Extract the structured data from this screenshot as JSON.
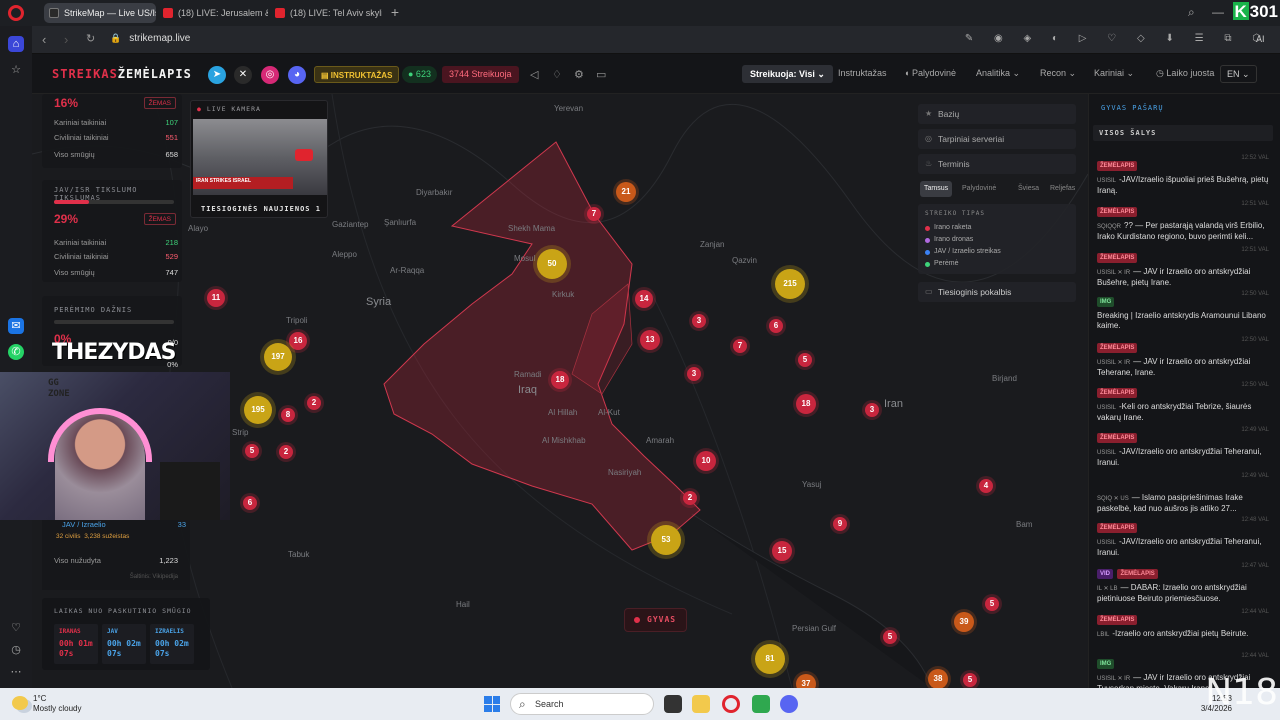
{
  "browser": {
    "tabs": [
      {
        "label": "StrikeMap — Live US/Isra"
      },
      {
        "label": "(18) LIVE: Jerusalem &"
      },
      {
        "label": "(18) LIVE: Tel Aviv skyline I"
      }
    ],
    "url": "strikemap.live",
    "ai_label": "AI",
    "corner_count": "301"
  },
  "header": {
    "logo_a": "STREIKAS",
    "logo_b": "ŽEMĖLAPIS",
    "instructions": "INSTRUKTAŽAS",
    "online_count": "● 623",
    "strike_count": "3744 Streikuoja",
    "menu_active": "Streikuoja: Visi ⌄",
    "menu": [
      "Instruktažas",
      "Palydovinė",
      "Analitika",
      "Recon",
      "Kariniai",
      "Laiko juosta"
    ],
    "lang": "EN ⌄"
  },
  "left_panel": {
    "top_pct": "16%",
    "top_badge": "ŽEMAS",
    "top_rows": [
      {
        "label": "Kariniai taikiniai",
        "value": "107"
      },
      {
        "label": "Civiliniai taikiniai",
        "value": "551"
      },
      {
        "label": "Viso smūgių",
        "value": "658"
      }
    ],
    "acc_title": "JAV/ISR TIKSLUMO TIKSLUMAS",
    "acc_pct": "29%",
    "acc_badge": "ŽEMAS",
    "acc_fill": 0.29,
    "acc_rows": [
      {
        "label": "Kariniai taikiniai",
        "value": "218"
      },
      {
        "label": "Civiliniai taikiniai",
        "value": "529"
      },
      {
        "label": "Viso smūgių",
        "value": "747"
      }
    ],
    "intercept_title": "PERĖMIMO DAŽNIS",
    "intercept_pct": "0%",
    "intercept_vals": [
      "0/0",
      "0%"
    ],
    "webcam_rows": {
      "side": "JAV / Izraelio",
      "side_val": "33",
      "civ": "32 civilis",
      "inj": "3,238 sužeistas",
      "killed_label": "Viso nužudyta",
      "killed_val": "1,223",
      "source": "Šaltinis: Vikipedija"
    }
  },
  "camera": {
    "title": "LIVE KAMERA",
    "news_text": "IRAN STRIKES ISRAEL",
    "footer": "TIESIOGINĖS NAUJIENOS 1"
  },
  "streamer": {
    "name": "THEZYDAS",
    "art": [
      "GG",
      "ZONE"
    ]
  },
  "map": {
    "labels": [
      {
        "t": "Yerevan",
        "cls": ""
      },
      {
        "t": "Diyarbakır",
        "cls": ""
      },
      {
        "t": "Gaziantep",
        "cls": ""
      },
      {
        "t": "Şanlıurfa",
        "cls": ""
      },
      {
        "t": "Aleppo",
        "cls": ""
      },
      {
        "t": "Ar-Raqqa",
        "cls": ""
      },
      {
        "t": "Shekh Mama",
        "cls": ""
      },
      {
        "t": "Mosul",
        "cls": ""
      },
      {
        "t": "Kirkuk",
        "cls": ""
      },
      {
        "t": "Zanjan",
        "cls": ""
      },
      {
        "t": "Qazvin",
        "cls": ""
      },
      {
        "t": "Syria",
        "cls": "big"
      },
      {
        "t": "Tripoli",
        "cls": ""
      },
      {
        "t": "Ramadi",
        "cls": ""
      },
      {
        "t": "Iraq",
        "cls": "big"
      },
      {
        "t": "Al Hillah",
        "cls": ""
      },
      {
        "t": "Al-Kut",
        "cls": ""
      },
      {
        "t": "Al Mishkhab",
        "cls": ""
      },
      {
        "t": "Amarah",
        "cls": ""
      },
      {
        "t": "Nasiriyah",
        "cls": ""
      },
      {
        "t": "Iran",
        "cls": "big"
      },
      {
        "t": "Birjand",
        "cls": ""
      },
      {
        "t": "Yasuj",
        "cls": ""
      },
      {
        "t": "Bam",
        "cls": ""
      },
      {
        "t": "Tabuk",
        "cls": ""
      },
      {
        "t": "Hail",
        "cls": ""
      },
      {
        "t": "Persian Gulf",
        "cls": ""
      },
      {
        "t": "Alayo",
        "cls": ""
      },
      {
        "t": "Strip",
        "cls": ""
      }
    ],
    "markers": [
      {
        "n": "21",
        "c": "orange"
      },
      {
        "n": "7",
        "c": "red"
      },
      {
        "n": "50",
        "c": "yellow"
      },
      {
        "n": "14",
        "c": "red"
      },
      {
        "n": "215",
        "c": "yellow"
      },
      {
        "n": "3",
        "c": "red"
      },
      {
        "n": "6",
        "c": "red"
      },
      {
        "n": "13",
        "c": "red"
      },
      {
        "n": "7",
        "c": "red"
      },
      {
        "n": "5",
        "c": "red"
      },
      {
        "n": "3",
        "c": "red"
      },
      {
        "n": "18",
        "c": "red"
      },
      {
        "n": "18",
        "c": "red"
      },
      {
        "n": "3",
        "c": "red"
      },
      {
        "n": "11",
        "c": "red"
      },
      {
        "n": "16",
        "c": "red"
      },
      {
        "n": "197",
        "c": "yellow"
      },
      {
        "n": "2",
        "c": "red"
      },
      {
        "n": "195",
        "c": "yellow"
      },
      {
        "n": "8",
        "c": "red"
      },
      {
        "n": "5",
        "c": "red"
      },
      {
        "n": "2",
        "c": "red"
      },
      {
        "n": "6",
        "c": "red"
      },
      {
        "n": "10",
        "c": "red"
      },
      {
        "n": "2",
        "c": "red"
      },
      {
        "n": "53",
        "c": "yellow"
      },
      {
        "n": "4",
        "c": "red"
      },
      {
        "n": "9",
        "c": "red"
      },
      {
        "n": "15",
        "c": "red"
      },
      {
        "n": "5",
        "c": "red"
      },
      {
        "n": "39",
        "c": "orange"
      },
      {
        "n": "5",
        "c": "red"
      },
      {
        "n": "81",
        "c": "yellow"
      },
      {
        "n": "37",
        "c": "orange"
      },
      {
        "n": "38",
        "c": "orange"
      },
      {
        "n": "5",
        "c": "red"
      }
    ],
    "live_label": "GYVAS"
  },
  "layers": {
    "items": [
      "Bazių",
      "Tarpiniai serveriai",
      "Terminis"
    ],
    "themes": [
      "Tamsus",
      "Palydovinė",
      "Šviesa",
      "Reljefas"
    ],
    "legend_title": "STREIKO TIPAS",
    "legend": [
      {
        "label": "Irano raketa",
        "color": "#e0304a"
      },
      {
        "label": "Irano dronas",
        "color": "#b06ae0"
      },
      {
        "label": "JAV / Izraelio streikas",
        "color": "#3b82f6"
      },
      {
        "label": "Perėmė",
        "color": "#3ed37a"
      }
    ],
    "chat": "Tiesioginis pokalbis"
  },
  "feed": {
    "title": "GYVAS PAŠARŲ",
    "filter": "VISOS ŠALYS",
    "items": [
      {
        "tag": "ŽEMĖLAPIS",
        "tagc": "zm",
        "time": "12:52 VAL",
        "src": "USISIL",
        "text": "-JAV/Izraelio išpuoliai prieš Bušehrą, pietų Iraną."
      },
      {
        "tag": "ŽEMĖLAPIS",
        "tagc": "zm",
        "time": "12:51 VAL",
        "src": "SQIQQR",
        "text": "?? — Per pastarąją valandą virš Erbilio, Irako Kurdistano regiono, buvo perimti keli..."
      },
      {
        "tag": "ŽEMĖLAPIS",
        "tagc": "zm",
        "time": "12:51 VAL",
        "src": "USISIL ✕ IR",
        "text": "— JAV ir Izraelio oro antskrydžiai Bušehre, pietų Irane."
      },
      {
        "tag": "IMG",
        "tagc": "img",
        "time": "12:50 VAL",
        "src": "",
        "text": "Breaking | Izraelio antskrydis Aramounui Libano kaime."
      },
      {
        "tag": "ŽEMĖLAPIS",
        "tagc": "zm",
        "time": "12:50 VAL",
        "src": "USISIL ✕ IR",
        "text": "— JAV ir Izraelio oro antskrydžiai Teherane, Irane."
      },
      {
        "tag": "ŽEMĖLAPIS",
        "tagc": "zm",
        "time": "12:50 VAL",
        "src": "USISIL",
        "text": "-Keli oro antskrydžiai Tebrize, šiaurės vakarų Irane."
      },
      {
        "tag": "ŽEMĖLAPIS",
        "tagc": "zm",
        "time": "12:49 VAL",
        "src": "USISIL",
        "text": "-JAV/Izraelio oro antskrydžiai Teheranui, Iranui."
      },
      {
        "tag": "",
        "tagc": "",
        "time": "12:49 VAL",
        "src": "SQIQ ✕ US",
        "text": "— Islamo pasipriešinimas Irake paskelbė, kad nuo aušros jis atliko 27..."
      },
      {
        "tag": "ŽEMĖLAPIS",
        "tagc": "zm",
        "time": "12:48 VAL",
        "src": "USISIL",
        "text": "-JAV/Izraelio oro antskrydžiai Teheranui, Iranui."
      },
      {
        "tag": "VID",
        "tagc": "vid",
        "tag2": "ŽEMĖLAPIS",
        "time": "12:47 VAL",
        "src": "IL ✕ LB",
        "text": "— DABAR: Izraelio oro antskrydžiai pietiniuose Beiruto priemiesčiuose."
      },
      {
        "tag": "ŽEMĖLAPIS",
        "tagc": "zm",
        "time": "12:44 VAL",
        "src": "LBIL",
        "text": "-Izraelio oro antskrydžiai pietų Beirute."
      },
      {
        "tag": "IMG",
        "tagc": "img",
        "time": "12:44 VAL",
        "src": "USISIL ✕ IR",
        "text": "— JAV ir Izraelio oro antskrydžiai Tuyserkan mieste, Vakarų Irane."
      }
    ]
  },
  "timer": {
    "title": "LAIKAS NUO PASKUTINIO SMŪGIO",
    "cols": [
      {
        "h": "IRANAS",
        "v1": "00h 01m",
        "v2": "07s",
        "color": "#e0304a"
      },
      {
        "h": "JAV",
        "v1": "00h 02m",
        "v2": "07s",
        "color": "#4aa3e8"
      },
      {
        "h": "IZRAELIS",
        "v1": "00h 02m",
        "v2": "07s",
        "color": "#4aa3e8"
      }
    ]
  },
  "taskbar": {
    "temp": "1°C",
    "weather": "Mostly cloudy",
    "search": "Search",
    "time": "12:53",
    "date": "3/4/2026",
    "watermark": "N18"
  }
}
